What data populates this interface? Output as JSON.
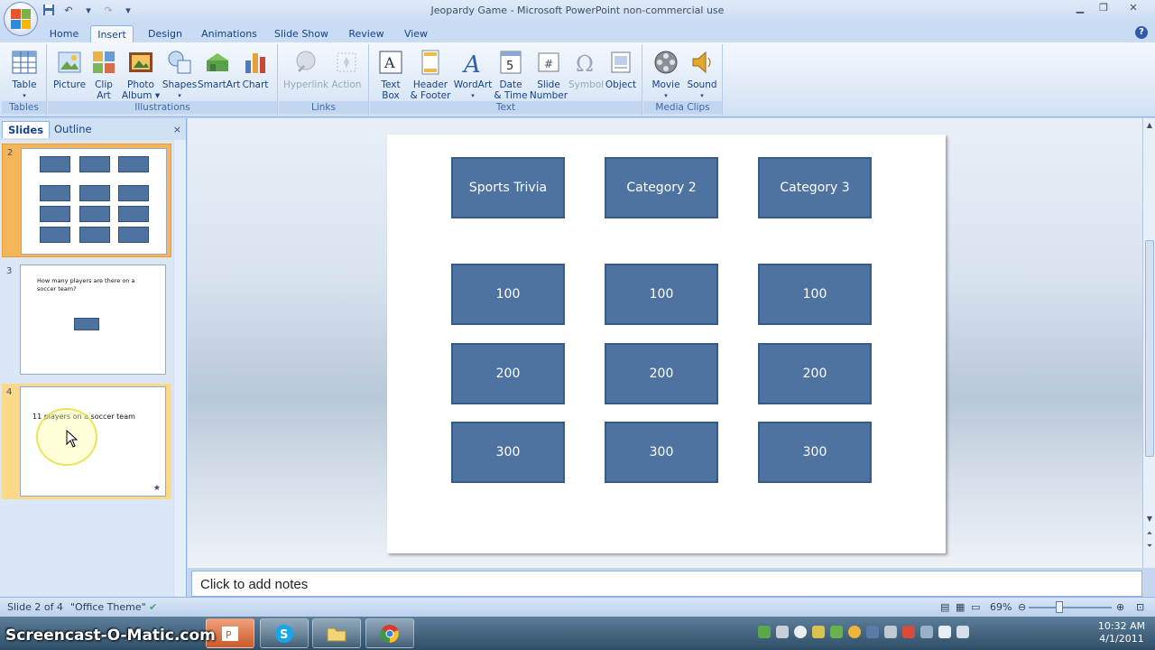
{
  "window": {
    "title": "Jeopardy Game - Microsoft PowerPoint non-commercial use"
  },
  "tabs": [
    "Home",
    "Insert",
    "Design",
    "Animations",
    "Slide Show",
    "Review",
    "View"
  ],
  "active_tab": "Insert",
  "ribbon": {
    "groups": {
      "tables": "Tables",
      "illustrations": "Illustrations",
      "links": "Links",
      "text": "Text",
      "media": "Media Clips"
    },
    "buttons": {
      "table": "Table",
      "picture": "Picture",
      "clip_art_1": "Clip",
      "clip_art_2": "Art",
      "photo_album_1": "Photo",
      "photo_album_2": "Album",
      "shapes": "Shapes",
      "smartart": "SmartArt",
      "chart": "Chart",
      "hyperlink": "Hyperlink",
      "action": "Action",
      "text_box_1": "Text",
      "text_box_2": "Box",
      "header_footer_1": "Header",
      "header_footer_2": "& Footer",
      "wordart": "WordArt",
      "date_time_1": "Date",
      "date_time_2": "& Time",
      "slide_number_1": "Slide",
      "slide_number_2": "Number",
      "symbol": "Symbol",
      "object": "Object",
      "movie": "Movie",
      "sound": "Sound"
    }
  },
  "left_panel": {
    "tab_slides": "Slides",
    "tab_outline": "Outline",
    "close": "×",
    "slides": [
      {
        "number": "2"
      },
      {
        "number": "3",
        "text": "How many players are there on a soccer team?"
      },
      {
        "number": "4",
        "text": "11 players on a soccer team",
        "star": "★"
      }
    ]
  },
  "slide": {
    "headers": [
      "Sports Trivia",
      "Category 2",
      "Category 3"
    ],
    "rows": [
      [
        "100",
        "100",
        "100"
      ],
      [
        "200",
        "200",
        "200"
      ],
      [
        "300",
        "300",
        "300"
      ]
    ]
  },
  "notes": {
    "placeholder": "Click to add notes"
  },
  "status": {
    "slide_counter": "Slide 2 of 4",
    "theme": "\"Office Theme\"",
    "zoom": "69%"
  },
  "taskbar": {
    "watermark": "Screencast-O-Matic.com",
    "time": "10:32 AM",
    "date": "4/1/2011"
  },
  "colors": {
    "box_fill": "#4f73a0",
    "box_border": "#355b88",
    "selected_slide": "#f5b65a"
  }
}
